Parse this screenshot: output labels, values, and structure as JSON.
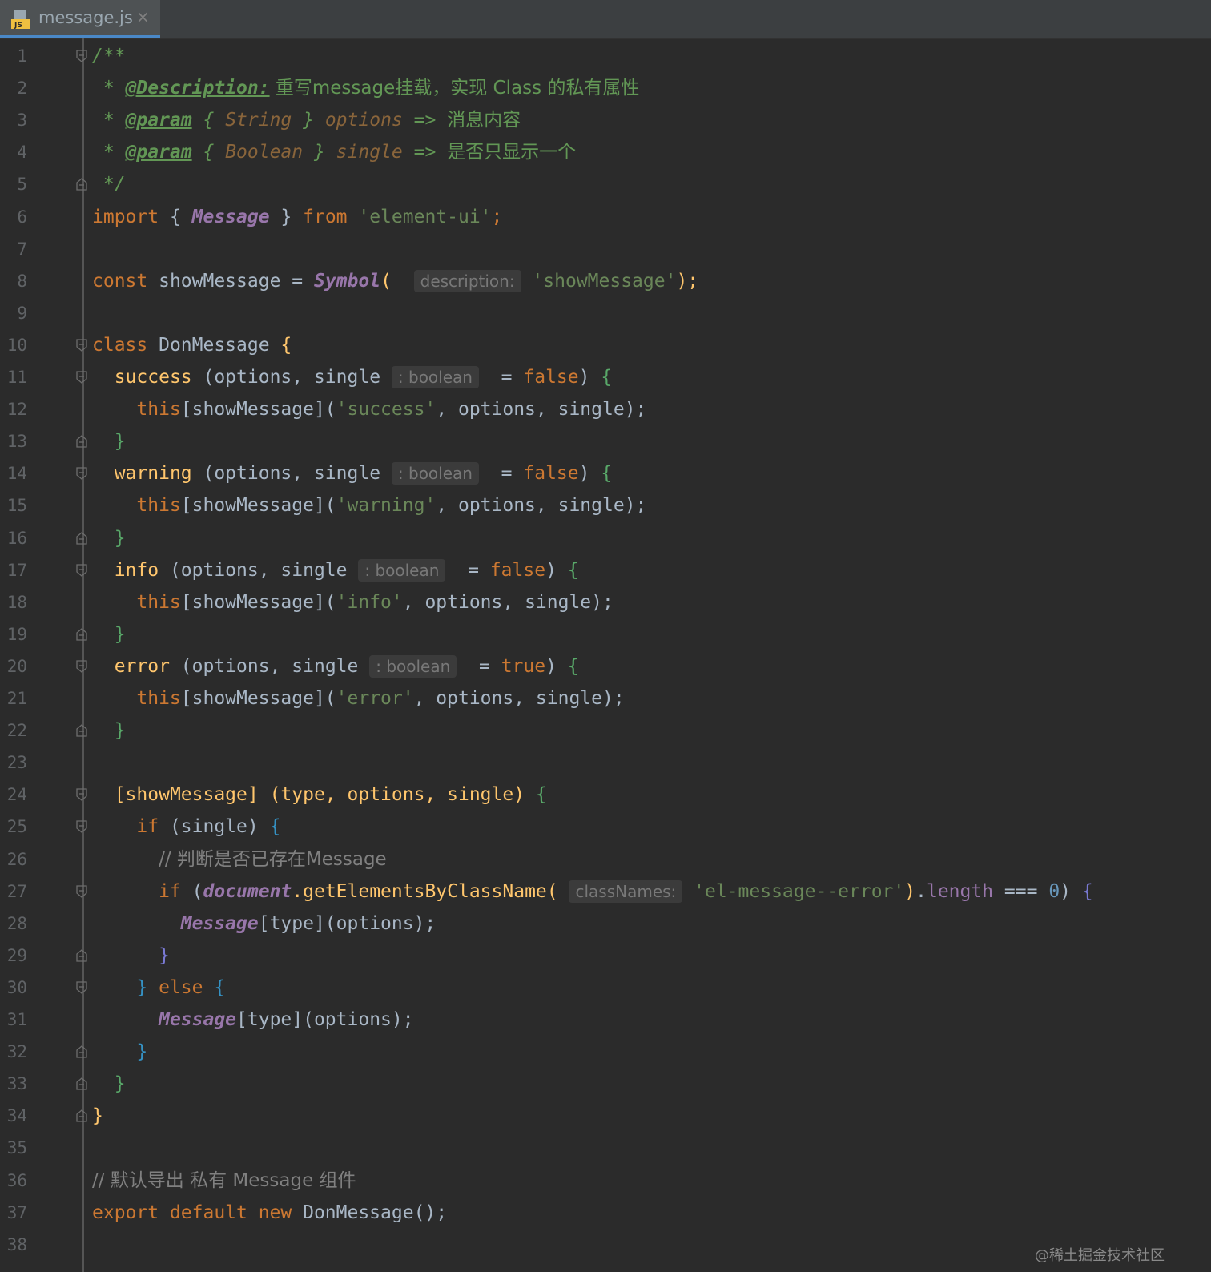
{
  "tab": {
    "filename": "message.js",
    "icon": "js-file-icon",
    "close": "×"
  },
  "hints": {
    "description": "description:",
    "boolean": ": boolean",
    "classNames": "classNames:"
  },
  "lines": [
    {
      "n": "1"
    },
    {
      "n": "2"
    },
    {
      "n": "3"
    },
    {
      "n": "4"
    },
    {
      "n": "5"
    },
    {
      "n": "6"
    },
    {
      "n": "7"
    },
    {
      "n": "8"
    },
    {
      "n": "9"
    },
    {
      "n": "10"
    },
    {
      "n": "11"
    },
    {
      "n": "12"
    },
    {
      "n": "13"
    },
    {
      "n": "14"
    },
    {
      "n": "15"
    },
    {
      "n": "16"
    },
    {
      "n": "17"
    },
    {
      "n": "18"
    },
    {
      "n": "19"
    },
    {
      "n": "20"
    },
    {
      "n": "21"
    },
    {
      "n": "22"
    },
    {
      "n": "23"
    },
    {
      "n": "24"
    },
    {
      "n": "25"
    },
    {
      "n": "26"
    },
    {
      "n": "27"
    },
    {
      "n": "28"
    },
    {
      "n": "29"
    },
    {
      "n": "30"
    },
    {
      "n": "31"
    },
    {
      "n": "32"
    },
    {
      "n": "33"
    },
    {
      "n": "34"
    },
    {
      "n": "35"
    },
    {
      "n": "36"
    },
    {
      "n": "37"
    },
    {
      "n": "38"
    }
  ],
  "code": {
    "l1": "/**",
    "l2_star": " * ",
    "l2_tag": "@Description:",
    "l2_text": " 重写message挂载，实现 Class 的私有属性",
    "l3_star": " * ",
    "l3_tag": "@param",
    "l3_open": " { ",
    "l3_type": "String",
    "l3_close": " } ",
    "l3_name": "options",
    "l3_arrow": " => ",
    "l3_text": "消息内容",
    "l4_star": " * ",
    "l4_tag": "@param",
    "l4_open": " { ",
    "l4_type": "Boolean",
    "l4_close": " } ",
    "l4_name": "single",
    "l4_arrow": " => ",
    "l4_text": "是否只显示一个",
    "l5": " */",
    "l6_import": "import",
    "l6_open": " { ",
    "l6_msg": "Message",
    "l6_close": " } ",
    "l6_from": "from",
    "l6_str": " 'element-ui'",
    "l6_semi": ";",
    "l8_const": "const",
    "l8_name": " showMessage = ",
    "l8_sym": "Symbol",
    "l8_paren": "( ",
    "l8_str": " 'showMessage'",
    "l8_end": ");",
    "l10_class": "class",
    "l10_name": " DonMessage ",
    "l10_brace": "{",
    "m_success": "success",
    "m_warning": "warning",
    "m_info": "info",
    "m_error": "error",
    "m_args": " (options, single",
    "m_eq": " = ",
    "m_false": "false",
    "m_true": "true",
    "m_close": ") ",
    "m_brace": "{",
    "c_this": "this",
    "c_call_open": "[showMessage](",
    "s_success": "'success'",
    "s_warning": "'warning'",
    "s_info": "'info'",
    "s_error": "'error'",
    "c_call_args": ", options, single);",
    "rbrace": "}",
    "l24_sig": "[showMessage] (type, options, single) ",
    "l24_brace": "{",
    "l25_if": "if",
    "l25_cond": " (single) ",
    "l25_brace": "{",
    "l26_cmt": "// 判断是否已存在Message",
    "l27_if": "if",
    "l27_open": " (",
    "l27_doc": "document",
    "l27_call": ".getElementsByClassName(",
    "l27_str": " 'el-message--error'",
    "l27_close": ")",
    "l27_dot": ".",
    "l27_len": "length",
    "l27_eq": " === ",
    "l27_zero": "0",
    "l27_paren": ") ",
    "l27_brace": "{",
    "l28_msg": "Message",
    "l28_rest": "[type](options);",
    "l30_close": "} ",
    "l30_else": "else",
    "l30_brace": " {",
    "l36_cmt": "// 默认导出 私有 Message 组件",
    "l37_export": "export default new",
    "l37_name": " DonMessage",
    "l37_rest": "();"
  },
  "watermark": "@稀土掘金技术社区"
}
